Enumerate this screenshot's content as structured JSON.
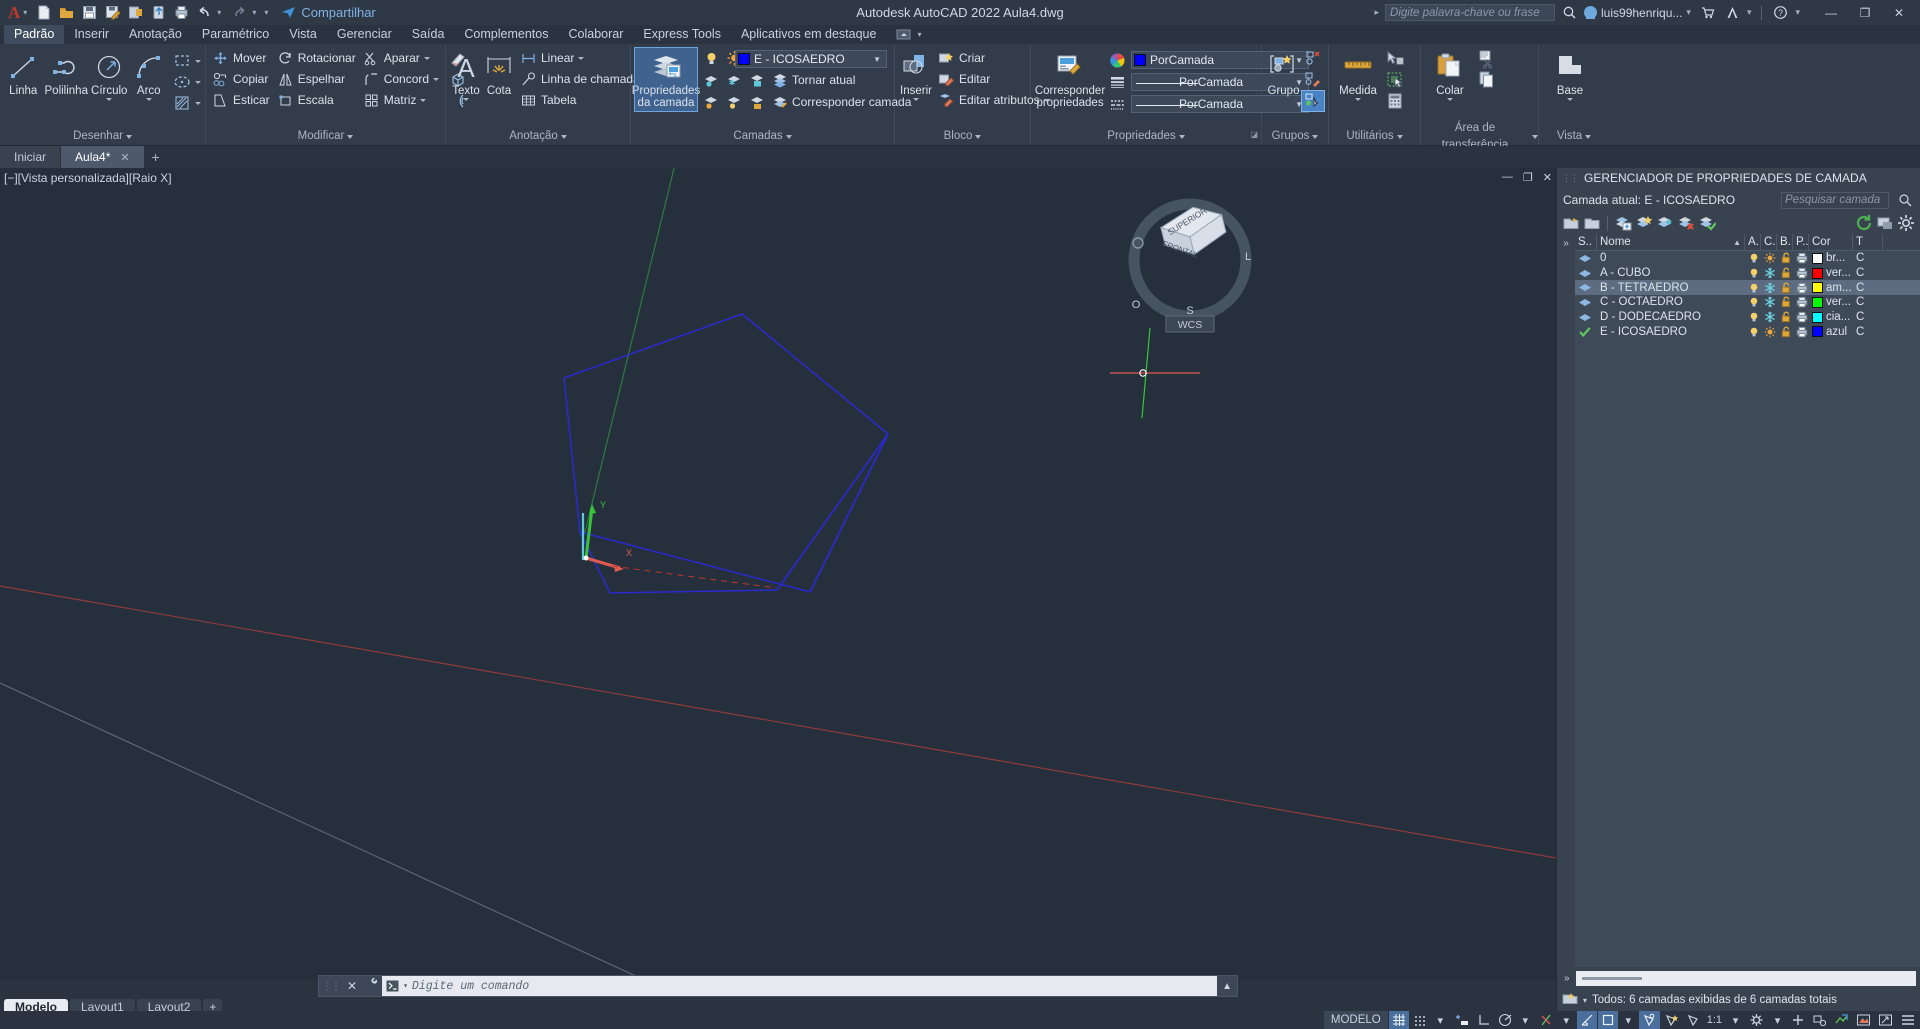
{
  "window": {
    "title": "Autodesk AutoCAD 2022    Aula4.dwg",
    "share_label": "Compartilhar",
    "search_placeholder": "Digite palavra-chave ou frase",
    "user": "luis99henriqu...",
    "minimize": "—",
    "maximize": "❐",
    "close": "✕"
  },
  "menu": {
    "items": [
      {
        "label": "Padrão",
        "active": true
      },
      {
        "label": "Inserir",
        "active": false
      },
      {
        "label": "Anotação",
        "active": false
      },
      {
        "label": "Paramétrico",
        "active": false
      },
      {
        "label": "Vista",
        "active": false
      },
      {
        "label": "Gerenciar",
        "active": false
      },
      {
        "label": "Saída",
        "active": false
      },
      {
        "label": "Complementos",
        "active": false
      },
      {
        "label": "Colaborar",
        "active": false
      },
      {
        "label": "Express Tools",
        "active": false
      },
      {
        "label": "Aplicativos em destaque",
        "active": false
      }
    ]
  },
  "ribbon": {
    "panels": [
      {
        "name": "Desenhar",
        "title": "Desenhar",
        "big": [
          {
            "label": "Linha",
            "icon": "line-icon",
            "dropdown": false
          },
          {
            "label": "Polilinha",
            "icon": "polyline-icon",
            "dropdown": false
          },
          {
            "label": "Círculo",
            "icon": "circle-icon",
            "dropdown": true
          },
          {
            "label": "Arco",
            "icon": "arc-icon",
            "dropdown": true
          }
        ],
        "flyouts": [
          {
            "icon": "rectangle-icon",
            "label": ""
          },
          {
            "icon": "ellipse-icon",
            "label": ""
          },
          {
            "icon": "hatch-icon",
            "label": ""
          }
        ]
      },
      {
        "name": "Modificar",
        "title": "Modificar",
        "items": [
          {
            "label": "Mover",
            "icon": "move-icon"
          },
          {
            "label": "Rotacionar",
            "icon": "rotate-icon"
          },
          {
            "label": "Aparar",
            "icon": "trim-icon",
            "dropdown": true
          },
          {
            "label": "Copiar",
            "icon": "copy-icon"
          },
          {
            "label": "Espelhar",
            "icon": "mirror-icon"
          },
          {
            "label": "Concord",
            "icon": "fillet-icon",
            "dropdown": true
          },
          {
            "label": "Esticar",
            "icon": "stretch-icon"
          },
          {
            "label": "Escala",
            "icon": "scale-icon"
          },
          {
            "label": "Matriz",
            "icon": "array-icon",
            "dropdown": true
          }
        ],
        "side_icons": [
          "eraser-icon",
          "explode-icon",
          "offset-icon"
        ]
      },
      {
        "name": "Anotação",
        "title": "Anotação",
        "big": [
          {
            "label": "Texto",
            "icon": "text-icon",
            "dropdown": true
          },
          {
            "label": "Cota",
            "icon": "dimension-icon",
            "dropdown": false
          }
        ],
        "items": [
          {
            "label": "Linear",
            "icon": "linear-dim-icon",
            "dropdown": true
          },
          {
            "label": "Linha de chamada",
            "icon": "leader-icon",
            "dropdown": true
          },
          {
            "label": "Tabela",
            "icon": "table-icon",
            "dropdown": false
          }
        ]
      },
      {
        "name": "Camadas",
        "title": "Camadas",
        "big": [
          {
            "label": "Propriedades\nda camada",
            "icon": "layer-properties-icon",
            "active": true
          }
        ],
        "current_layer": "E - ICOSAEDRO",
        "current_layer_color": "#0000ff",
        "items": [
          {
            "label": "Tornar atual",
            "icon": "make-current-icon"
          },
          {
            "label": "Corresponder camada",
            "icon": "layer-match-icon"
          }
        ]
      },
      {
        "name": "Bloco",
        "title": "Bloco",
        "big": [
          {
            "label": "Inserir",
            "icon": "insert-block-icon",
            "dropdown": true
          }
        ],
        "items": [
          {
            "label": "Criar",
            "icon": "create-block-icon"
          },
          {
            "label": "Editar",
            "icon": "edit-block-icon"
          },
          {
            "label": "Editar atributos",
            "icon": "edit-attributes-icon",
            "dropdown": true
          }
        ]
      },
      {
        "name": "Propriedades",
        "title": "Propriedades",
        "big": [
          {
            "label": "Corresponder\npropriedades",
            "icon": "match-properties-icon"
          }
        ],
        "combos": [
          {
            "label": "PorCamada",
            "icon": "color-wheel-icon",
            "swatch": "#0000ff"
          },
          {
            "label": "PorCamada",
            "icon": "linewidth-icon",
            "swatch": ""
          },
          {
            "label": "PorCamada",
            "icon": "linetype-icon",
            "swatch": ""
          }
        ]
      },
      {
        "name": "Grupos",
        "title": "Grupos",
        "big": [
          {
            "label": "Grupo",
            "icon": "group-icon"
          }
        ],
        "side_icons": [
          "ungroup-icon",
          "group-edit-icon",
          "group-selection-icon"
        ]
      },
      {
        "name": "Utilitários",
        "title": "Utilitários",
        "big": [
          {
            "label": "Medida",
            "icon": "measure-icon",
            "dropdown": true
          }
        ],
        "side_icons": [
          "quick-select-icon",
          "select-all-icon",
          "calculator-icon"
        ]
      },
      {
        "name": "Área de transferência",
        "title": "Área de transferência",
        "big": [
          {
            "label": "Colar",
            "icon": "paste-icon",
            "dropdown": true
          }
        ],
        "side_icons": [
          "cut-icon",
          "copy-clip-icon"
        ]
      },
      {
        "name": "Vista",
        "title": "Vista",
        "big": [
          {
            "label": "Base",
            "icon": "base-view-icon",
            "dropdown": true
          }
        ]
      }
    ]
  },
  "filetabs": {
    "tabs": [
      {
        "label": "Iniciar",
        "active": false,
        "closable": false
      },
      {
        "label": "Aula4*",
        "active": true,
        "closable": true
      }
    ],
    "plus": "+"
  },
  "viewport": {
    "label": "[−][Vista personalizada][Raio X]",
    "minimize": "—",
    "restore": "❐",
    "close": "✕",
    "wcs_label": "WCS",
    "cube_top": "SUPERIOR",
    "cube_front": "FRONTAL",
    "cube_left": "L",
    "cube_s": "S",
    "cube_o": "O"
  },
  "command": {
    "placeholder": "Digite um comando",
    "close": "✕",
    "wrench": "⚒"
  },
  "layouttabs": {
    "tabs": [
      {
        "label": "Modelo",
        "active": true
      },
      {
        "label": "Layout1",
        "active": false
      },
      {
        "label": "Layout2",
        "active": false
      }
    ],
    "plus": "+"
  },
  "statusbar": {
    "space": "MODELO",
    "scale": "1:1",
    "items": [
      {
        "name": "grid-mode-toggle",
        "icon": "grid-icon",
        "on": true
      },
      {
        "name": "snap-mode-toggle",
        "icon": "snap-icon",
        "on": false
      },
      {
        "name": "snap-dropdown",
        "icon": "chevron-down-icon",
        "on": false
      },
      {
        "name": "infer-constraints-toggle",
        "icon": "infer-icon",
        "on": false
      },
      {
        "name": "ortho-mode-toggle",
        "icon": "ortho-icon",
        "on": false
      },
      {
        "name": "polar-tracking-toggle",
        "icon": "polar-icon",
        "on": false
      },
      {
        "name": "polar-dropdown",
        "icon": "chevron-down-icon",
        "on": false
      },
      {
        "name": "osnap-toggle",
        "icon": "osnap-icon",
        "on": false
      },
      {
        "name": "osnap-dropdown",
        "icon": "chevron-down-icon",
        "on": false
      },
      {
        "name": "otrack-toggle",
        "icon": "otrack-icon",
        "on": true
      },
      {
        "name": "ucs-icon-toggle",
        "icon": "ucs-icon",
        "on": true
      },
      {
        "name": "ucs-dropdown",
        "icon": "chevron-down-icon",
        "on": false
      },
      {
        "name": "dyn-ucs-toggle",
        "icon": "dynucs-icon",
        "on": true
      },
      {
        "name": "selection-cycling-toggle",
        "icon": "cycling-icon",
        "on": false
      },
      {
        "name": "annotation-visibility-toggle",
        "icon": "annovis-icon",
        "on": false
      }
    ],
    "right_items": [
      {
        "name": "workspace-settings",
        "icon": "gear-icon"
      },
      {
        "name": "workspace-dropdown",
        "icon": "chevron-down-icon"
      },
      {
        "name": "isolate-objects",
        "icon": "plus-icon"
      },
      {
        "name": "hardware-acceleration",
        "icon": "graphics-icon"
      },
      {
        "name": "clean-screen",
        "icon": "isolate-icon"
      },
      {
        "name": "units-icon",
        "icon": "units-icon"
      },
      {
        "name": "fullscreen-toggle",
        "icon": "expand-icon"
      },
      {
        "name": "customization-menu",
        "icon": "hamburger-icon"
      }
    ]
  },
  "layer_manager": {
    "title": "GERENCIADOR DE PROPRIEDADES DE CAMADA",
    "current_label": "Camada atual: E - ICOSAEDRO",
    "search_placeholder": "Pesquisar camada",
    "columns": [
      "S..",
      "Nome",
      "A.",
      "C.",
      "B..",
      "P..",
      "Cor",
      "T"
    ],
    "rows": [
      {
        "status": "layer-icon",
        "name": "0",
        "on": "bulb-on",
        "freeze": "sun",
        "lock": "unlocked",
        "plot": "plotter",
        "color_name": "br...",
        "color": "#ffffff",
        "selected": false,
        "current": false
      },
      {
        "status": "layer-icon",
        "name": "A - CUBO",
        "on": "bulb-on",
        "freeze": "snowflake",
        "lock": "unlocked",
        "plot": "plotter",
        "color_name": "ver...",
        "color": "#ff0000",
        "selected": false,
        "current": false
      },
      {
        "status": "layer-icon",
        "name": "B - TETRAEDRO",
        "on": "bulb-on",
        "freeze": "snowflake",
        "lock": "unlocked",
        "plot": "plotter",
        "color_name": "am...",
        "color": "#ffff00",
        "selected": true,
        "current": false
      },
      {
        "status": "layer-icon",
        "name": "C - OCTAEDRO",
        "on": "bulb-on",
        "freeze": "snowflake",
        "lock": "unlocked",
        "plot": "plotter",
        "color_name": "ver...",
        "color": "#00ff00",
        "selected": false,
        "current": false
      },
      {
        "status": "layer-icon",
        "name": "D - DODECAEDRO",
        "on": "bulb-on",
        "freeze": "snowflake",
        "lock": "unlocked",
        "plot": "plotter",
        "color_name": "cia...",
        "color": "#00ffff",
        "selected": false,
        "current": false
      },
      {
        "status": "check-icon",
        "name": "E - ICOSAEDRO",
        "on": "bulb-on",
        "freeze": "sun",
        "lock": "unlocked",
        "plot": "plotter",
        "color_name": "azul",
        "color": "#0000ff",
        "selected": false,
        "current": true
      }
    ],
    "status_text": "Todos: 6 camadas exibidas de 6 camadas totais",
    "toolbar": [
      {
        "name": "new-layer-button",
        "icon": "new-layer-icon"
      },
      {
        "name": "new-layer-vp-frozen-button",
        "icon": "new-layer-vp-icon"
      },
      {
        "name": "new-property-filter-button",
        "icon": "property-filter-icon"
      },
      {
        "name": "new-group-filter-button",
        "icon": "group-filter-icon"
      },
      {
        "name": "layer-states-button",
        "icon": "layer-states-icon"
      },
      {
        "name": "delete-layer-button",
        "icon": "delete-layer-icon"
      },
      {
        "name": "set-current-button",
        "icon": "set-current-icon"
      },
      {
        "name": "refresh-button",
        "icon": "refresh-icon"
      },
      {
        "name": "vp-freeze-button",
        "icon": "vp-freeze-icon"
      },
      {
        "name": "settings-button",
        "icon": "gear-icon"
      }
    ]
  },
  "colors": {
    "accent": "#4a83c4",
    "panel_bg": "#333c4a",
    "canvas_bg": "#26303c",
    "drawing_blue": "#2a2ad0",
    "axis_green": "#00b050",
    "axis_red": "#c0392b"
  }
}
